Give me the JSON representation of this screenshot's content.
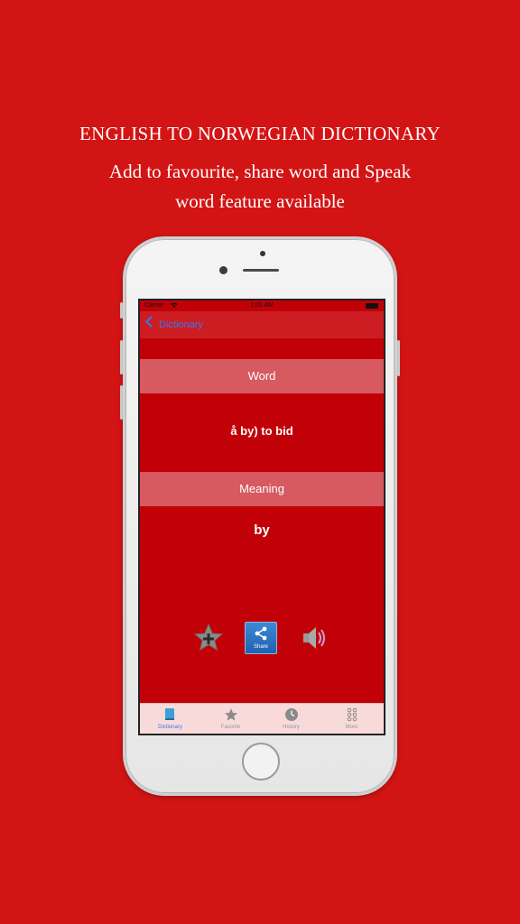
{
  "promo": {
    "title": "ENGLISH TO NORWEGIAN DICTIONARY",
    "subtitle_line1": "Add to favourite, share word  and Speak",
    "subtitle_line2": "word feature available"
  },
  "status_bar": {
    "carrier": "Carrier",
    "time": "1:01 AM"
  },
  "nav": {
    "back_label": "Dictionary"
  },
  "content": {
    "word_header": "Word",
    "word_value": "å by) to bid",
    "meaning_header": "Meaning",
    "meaning_value": "by"
  },
  "actions": {
    "favorite_icon": "star-plus-icon",
    "share_label": "Share",
    "speak_icon": "speaker-icon"
  },
  "tab_bar": {
    "tabs": [
      {
        "label": "Dictionary",
        "icon": "book-icon",
        "active": true
      },
      {
        "label": "Favorite",
        "icon": "star-icon",
        "active": false
      },
      {
        "label": "History",
        "icon": "clock-icon",
        "active": false
      },
      {
        "label": "More",
        "icon": "more-dots-icon",
        "active": false
      }
    ]
  },
  "colors": {
    "background": "#d31414",
    "app_background": "#c20008",
    "section_header": "#d65a60",
    "accent_blue": "#3478f6",
    "tab_bar": "#f9dada"
  }
}
